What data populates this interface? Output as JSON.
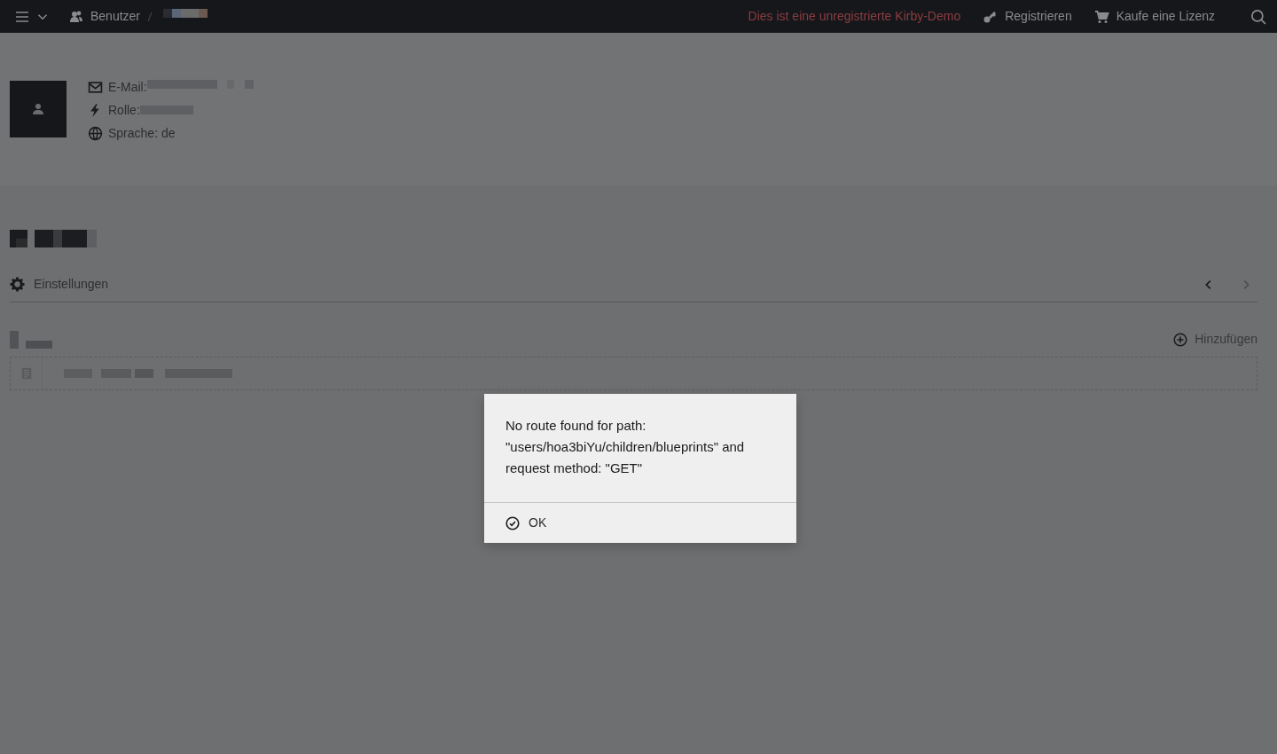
{
  "topbar": {
    "breadcrumb": [
      {
        "label": "Benutzer",
        "kind": "users"
      }
    ],
    "notice": "Dies ist eine unregistrierte Kirby-Demo",
    "links": [
      {
        "label": "Registrieren",
        "kind": "key"
      },
      {
        "label": "Kaufe eine Lizenz",
        "kind": "cart"
      }
    ]
  },
  "profile": {
    "fields": [
      {
        "label": "E-Mail:",
        "kind": "email"
      },
      {
        "label": "Rolle:",
        "kind": "role"
      },
      {
        "label": "Sprache: de",
        "kind": "language"
      }
    ]
  },
  "tabs": [
    {
      "label": "Einstellungen"
    }
  ],
  "pager": {
    "prev_disabled": false,
    "next_disabled": true
  },
  "section": {
    "add_label": "Hinzufügen"
  },
  "dialog": {
    "message": "No route found for path: \"users/hoa3biYu/children/blueprints\" and request method: \"GET\"",
    "button": "OK"
  }
}
